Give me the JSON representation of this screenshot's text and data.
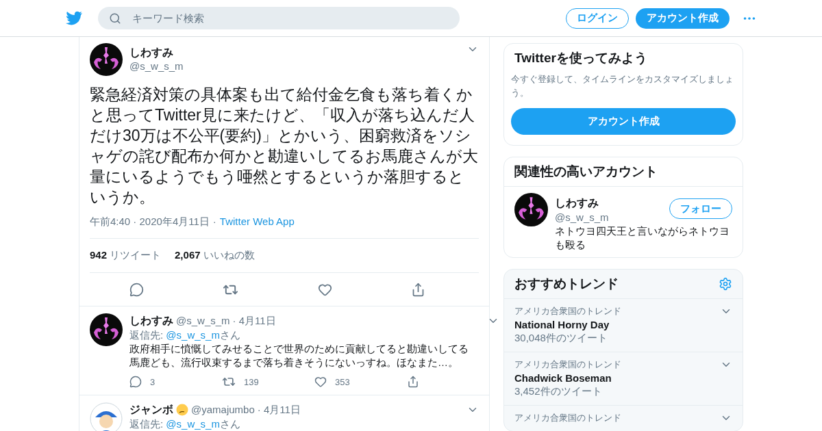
{
  "header": {
    "search_placeholder": "キーワード検索",
    "login": "ログイン",
    "signup": "アカウント作成"
  },
  "tweet": {
    "name": "しわすみ",
    "handle": "@s_w_s_m",
    "text": "緊急経済対策の具体案も出て給付金乞食も落ち着くかと思ってTwitter見に来たけど、「収入が落ち込んだ人だけ30万は不公平(要約)」とかいう、困窮救済をソシャゲの詫び配布か何かと勘違いしてるお馬鹿さんが大量にいるようでもう唖然とするというか落胆するというか。",
    "time": "午前4:40 · 2020年4月11日",
    "separator": "·",
    "source": "Twitter Web App",
    "retweets": {
      "count": "942",
      "label": "リツイート"
    },
    "likes": {
      "count": "2,067",
      "label": "いいねの数"
    }
  },
  "replies": [
    {
      "name": "しわすみ",
      "emoji": false,
      "handle": "@s_w_s_m",
      "date": "· 4月11日",
      "reply_to": {
        "label": "返信先: ",
        "mention": "@s_w_s_m",
        "suffix": "さん"
      },
      "text": "政府相手に憤慨してみせることで世界のために貢献してると勘違いしてる馬鹿ども、流行収束するまで落ち着きそうにないっすね。ほなまた…。",
      "replies": "3",
      "retweets": "139",
      "likes": "353"
    },
    {
      "name": "ジャンボ",
      "emoji": true,
      "handle": "@yamajumbo",
      "date": "· 4月11日",
      "reply_to": {
        "label": "返信先: ",
        "mention": "@s_w_s_m",
        "suffix": "さん"
      }
    }
  ],
  "signup_card": {
    "title": "Twitterを使ってみよう",
    "text": "今すぐ登録して、タイムラインをカスタマイズしましょう。",
    "button": "アカウント作成"
  },
  "related": {
    "title": "関連性の高いアカウント",
    "accounts": [
      {
        "name": "しわすみ",
        "handle": "@s_w_s_m",
        "bio": "ネトウヨ四天王と言いながらネトウヨも殴る",
        "button": "フォロー"
      }
    ]
  },
  "trends": {
    "title": "おすすめトレンド",
    "items": [
      {
        "context": "アメリカ合衆国のトレンド",
        "name": "National Horny Day",
        "count": "30,048件のツイート"
      },
      {
        "context": "アメリカ合衆国のトレンド",
        "name": "Chadwick Boseman",
        "count": "3,452件のツイート"
      },
      {
        "context": "アメリカ合衆国のトレンド"
      }
    ]
  }
}
